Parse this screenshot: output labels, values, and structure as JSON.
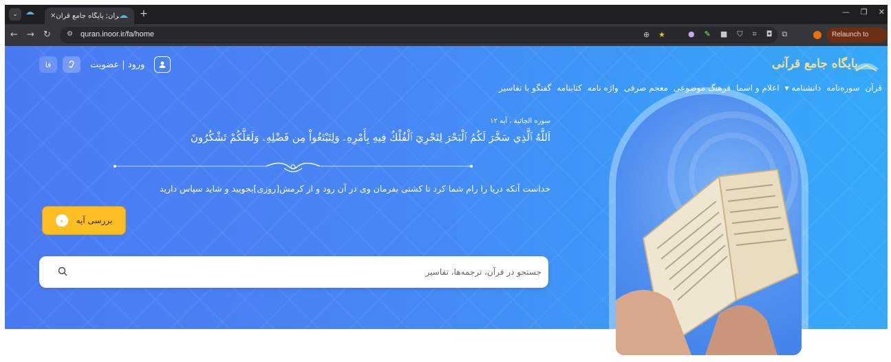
{
  "browser": {
    "tab_title": "قرآن; پایگاه جامع قرآن",
    "url": "quran.inoor.ir/fa/home",
    "relaunch_label": "Relaunch to update"
  },
  "header": {
    "lang_label": "فا",
    "login_label": "ورود | عضویت",
    "logo_text": "پایگاه جامع قرآنی"
  },
  "nav": {
    "items": [
      "قرآن",
      "سوره‌نامه",
      "دانشنامه ▾",
      "اعلام و اسما",
      "فرهنگ موضوعی",
      "معجم صرفی",
      "واژه نامه",
      "کتابنامه",
      "گفتگو با تفاسیر"
    ]
  },
  "verse": {
    "reference": "سوره الجاثیة ، آیه ۱۲",
    "arabic": "اَللَّهُ ٱلَّذِي سَخَّرَ لَكُمُ ٱلْبَحْرَ لِتَجْرِيَ ٱلْفُلْكُ فِيهِ بِأَمْرِهِۦ وَلِتَبْتَغُواْ مِن فَضْلِهِۦ وَلَعَلَّكُمْ تَشْكُرُونَ",
    "translation": "خداست آنکه دریا را رام شما کرد تا کشتی بفرمان وی در آن رود و از کرمش[روزی]بجویید و شاید سپاس دارید",
    "button_label": "بررسی آیه"
  },
  "search": {
    "placeholder": "جستجو در قرآن، ترجمه‌ها، تفاسیر"
  },
  "colors": {
    "hero_start": "#4a7af3",
    "hero_end": "#36a9fa",
    "cta": "#fbbf24"
  }
}
